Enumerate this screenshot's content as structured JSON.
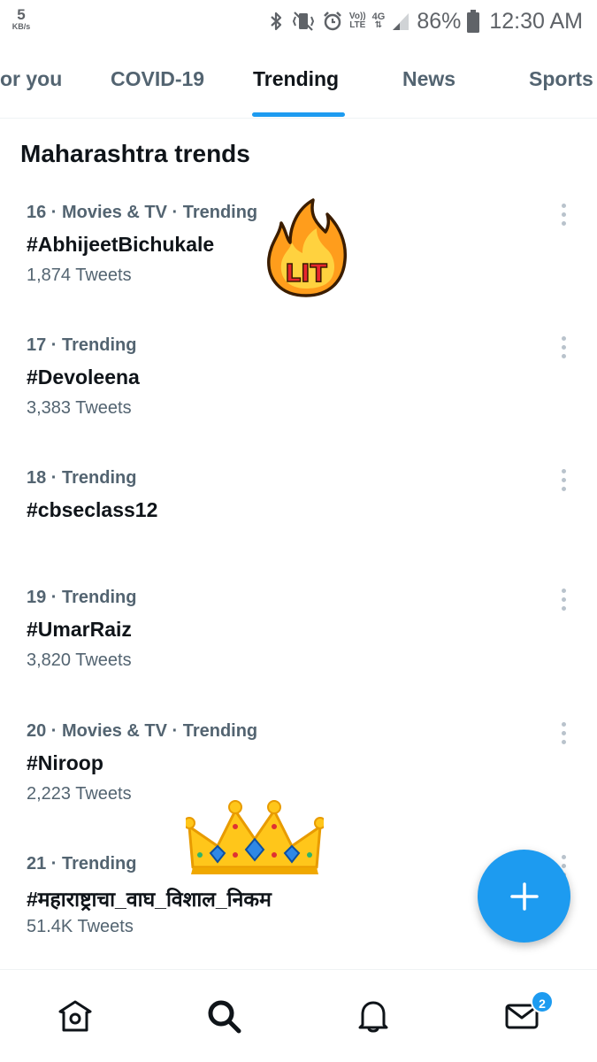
{
  "status_bar": {
    "net_speed_value": "5",
    "net_speed_unit": "KB/s",
    "volte_top": "Vo))",
    "volte_bottom": "LTE",
    "network_type": "4G",
    "battery_percent": "86%",
    "time": "12:30 AM",
    "icons": [
      "bluetooth-icon",
      "vibrate-icon",
      "alarm-icon",
      "volte-icon",
      "network-4g-icon",
      "signal-icon",
      "battery-icon"
    ]
  },
  "tabs": [
    {
      "label": "or you"
    },
    {
      "label": "COVID-19"
    },
    {
      "label": "Trending",
      "active": true
    },
    {
      "label": "News"
    },
    {
      "label": "Sports"
    }
  ],
  "section_title": "Maharashtra trends",
  "trends": [
    {
      "meta": "16 · Movies & TV · Trending",
      "tag": "#AbhijeetBichukale",
      "count": "1,874 Tweets"
    },
    {
      "meta": "17 · Trending",
      "tag": "#Devoleena",
      "count": "3,383 Tweets"
    },
    {
      "meta": "18 · Trending",
      "tag": "#cbseclass12",
      "count": ""
    },
    {
      "meta": "19 · Trending",
      "tag": "#UmarRaiz",
      "count": "3,820 Tweets"
    },
    {
      "meta": "20 · Movies & TV · Trending",
      "tag": "#Niroop",
      "count": "2,223 Tweets"
    },
    {
      "meta": "21 · Trending",
      "tag": "#महाराष्ट्राचा_वाघ_विशाल_निकम",
      "count": "51.4K Tweets"
    }
  ],
  "stickers": {
    "lit_text": "LIT"
  },
  "bottom_nav": {
    "items": [
      "home-icon",
      "search-icon",
      "notifications-icon",
      "messages-icon"
    ],
    "messages_badge": "2"
  },
  "colors": {
    "accent": "#1d9bf0",
    "primary_text": "#0f1419",
    "secondary_text": "#536471",
    "divider": "#eff3f4"
  }
}
